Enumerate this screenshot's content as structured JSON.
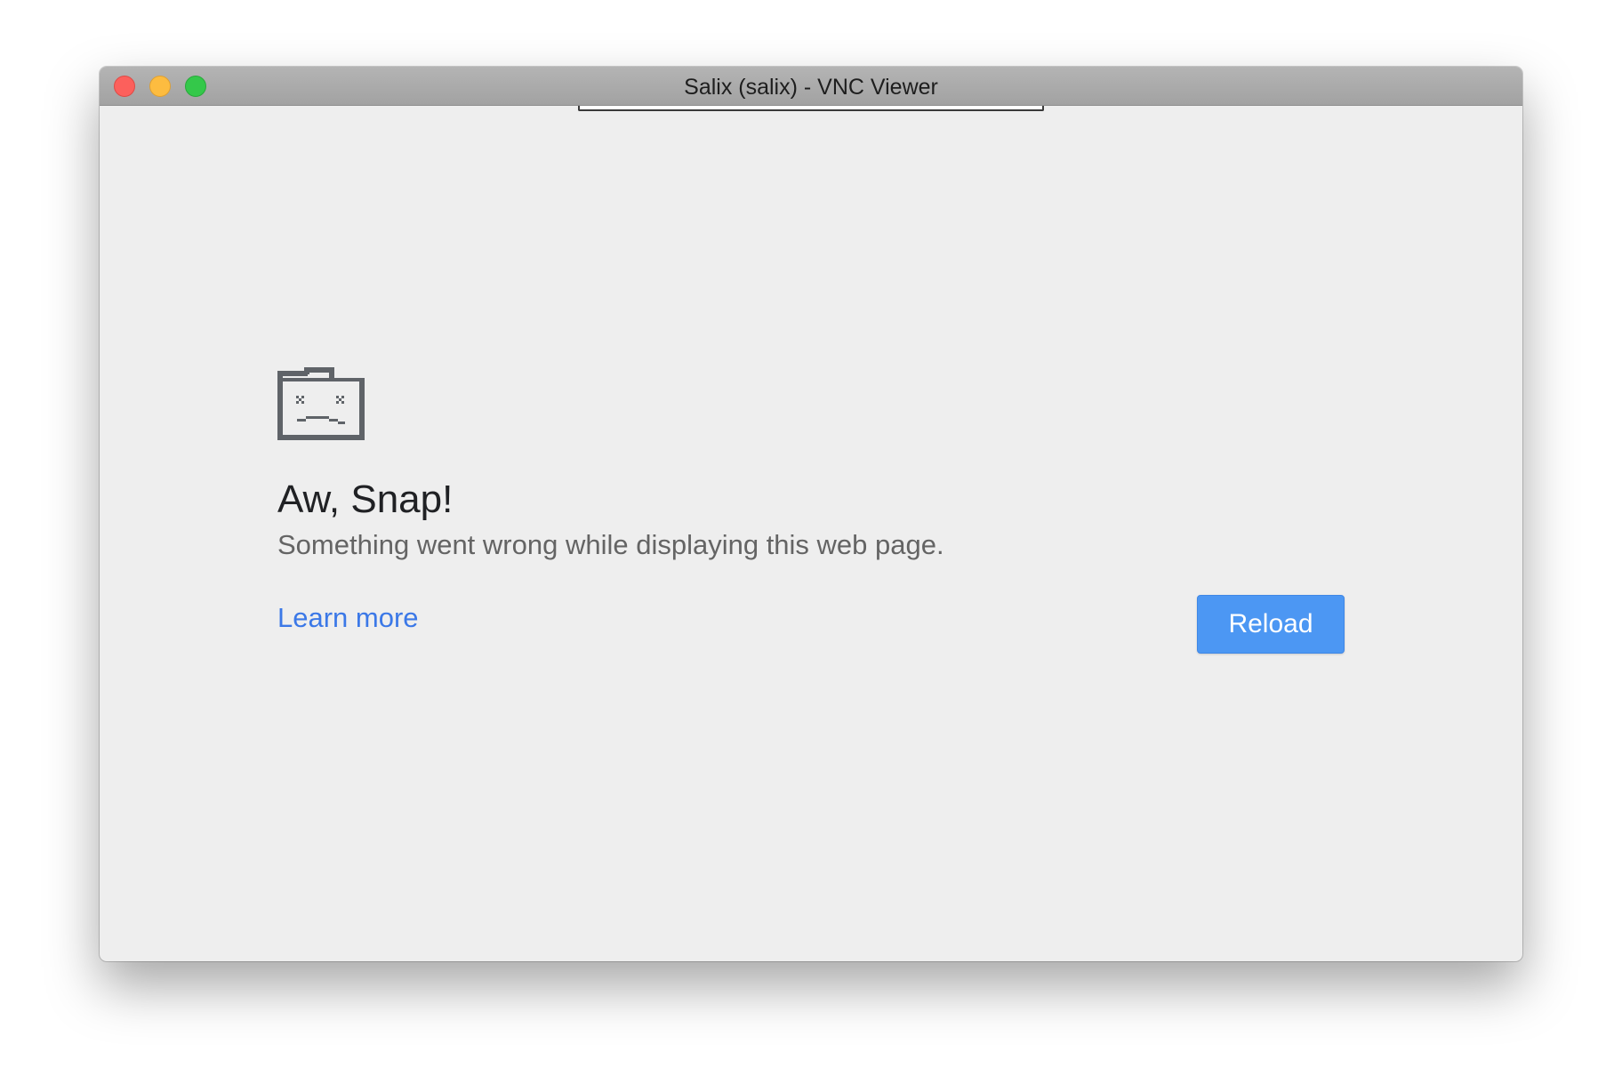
{
  "window": {
    "title": "Salix (salix) - VNC Viewer",
    "controls": {
      "close_icon": "close-icon",
      "minimize_icon": "minimize-icon",
      "maximize_icon": "maximize-icon"
    }
  },
  "error_page": {
    "icon": "sad-tab-icon",
    "heading": "Aw, Snap!",
    "message": "Something went wrong while displaying this web page.",
    "learn_more_label": "Learn more",
    "reload_label": "Reload"
  },
  "colors": {
    "background": "#eeeeee",
    "link": "#3b78e7",
    "button": "#4c97f3",
    "traffic_close": "#fc605c",
    "traffic_minimize": "#fdbc40",
    "traffic_maximize": "#34c84a"
  }
}
